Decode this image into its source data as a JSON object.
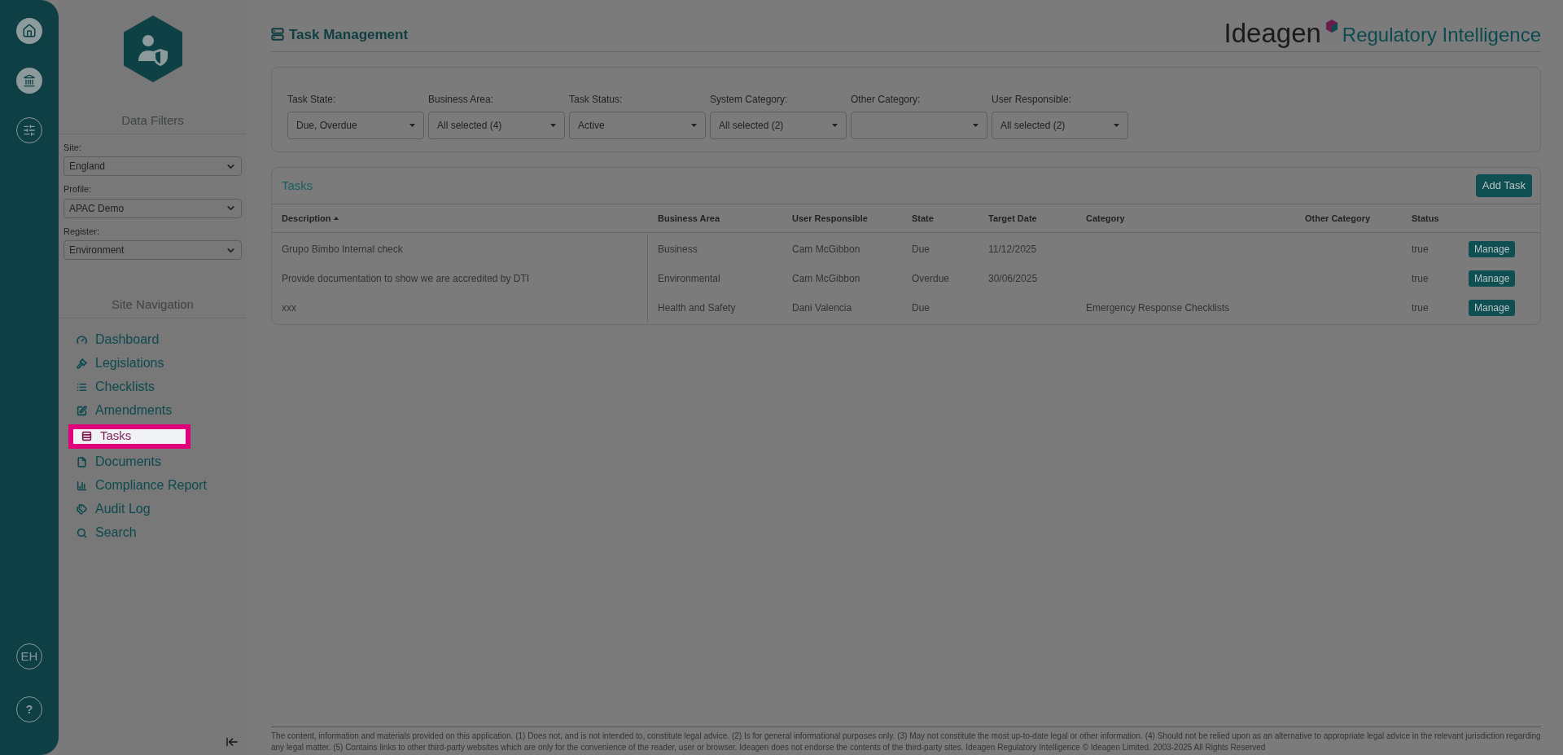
{
  "rail": {
    "avatar": "EH",
    "help": "?"
  },
  "sidebar": {
    "filters_title": "Data Filters",
    "filters": [
      {
        "label": "Site:",
        "value": "England"
      },
      {
        "label": "Profile:",
        "value": "APAC Demo"
      },
      {
        "label": "Register:",
        "value": "Environment"
      }
    ],
    "nav_title": "Site Navigation",
    "nav": [
      {
        "kind": "dashboard",
        "label": "Dashboard",
        "selected": false
      },
      {
        "kind": "legislations",
        "label": "Legislations",
        "selected": false
      },
      {
        "kind": "checklists",
        "label": "Checklists",
        "selected": false
      },
      {
        "kind": "amendments",
        "label": "Amendments",
        "selected": false
      },
      {
        "kind": "tasks",
        "label": "Tasks",
        "selected": true
      },
      {
        "kind": "documents",
        "label": "Documents",
        "selected": false
      },
      {
        "kind": "report",
        "label": "Compliance Report",
        "selected": false
      },
      {
        "kind": "audit",
        "label": "Audit Log",
        "selected": false
      },
      {
        "kind": "search",
        "label": "Search",
        "selected": false
      }
    ]
  },
  "header": {
    "title": "Task Management",
    "brand": "Ideagen",
    "product": "Regulatory Intelligence"
  },
  "filters": [
    {
      "label": "Task State:",
      "value": "Due, Overdue"
    },
    {
      "label": "Business Area:",
      "value": "All selected (4)"
    },
    {
      "label": "Task Status:",
      "value": "Active"
    },
    {
      "label": "System Category:",
      "value": "All selected (2)"
    },
    {
      "label": "Other Category:"
    },
    {
      "label": "User Responsible:",
      "value": "All selected (2)"
    }
  ],
  "tasks": {
    "title": "Tasks",
    "add_button": "Add Task",
    "columns": [
      {
        "label": "Description",
        "sorted": true
      },
      {
        "label": "Business Area"
      },
      {
        "label": "User Responsible"
      },
      {
        "label": "State"
      },
      {
        "label": "Target Date"
      },
      {
        "label": "Category"
      },
      {
        "label": "Other Category"
      },
      {
        "label": "Status"
      }
    ],
    "rows": [
      {
        "description": "Grupo Bimbo Internal check",
        "business_area": "Business",
        "user_responsible": "Cam McGibbon",
        "state": "Due",
        "target_date": "11/12/2025",
        "status": "true",
        "action": "Manage"
      },
      {
        "description": "Provide documentation to show we are accredited by DTI",
        "business_area": "Environmental",
        "user_responsible": "Cam McGibbon",
        "state": "Overdue",
        "target_date": "30/06/2025",
        "status": "true",
        "action": "Manage"
      },
      {
        "description": "xxx",
        "business_area": "Health and Safety",
        "user_responsible": "Dani Valencia",
        "state": "Due",
        "category": "Emergency Response Checklists",
        "status": "true",
        "action": "Manage"
      }
    ]
  },
  "footer": "The content, information and materials provided on this application. (1) Does not, and is not intended to, constitute legal advice. (2) Is for general informational purposes only. (3) May not constitute the most up-to-date legal or other information. (4) Should not be relied upon as an alternative to appropriate legal advice in the relevant jurisdiction regarding any legal matter. (5) Contains links to other third-party websites which are only for the convenience of the reader, user or browser. Ideagen does not endorse the contents of the third-party sites. Ideagen Regulatory Intelligence © Ideagen Limited. 2003-2025 All Rights Reserved"
}
